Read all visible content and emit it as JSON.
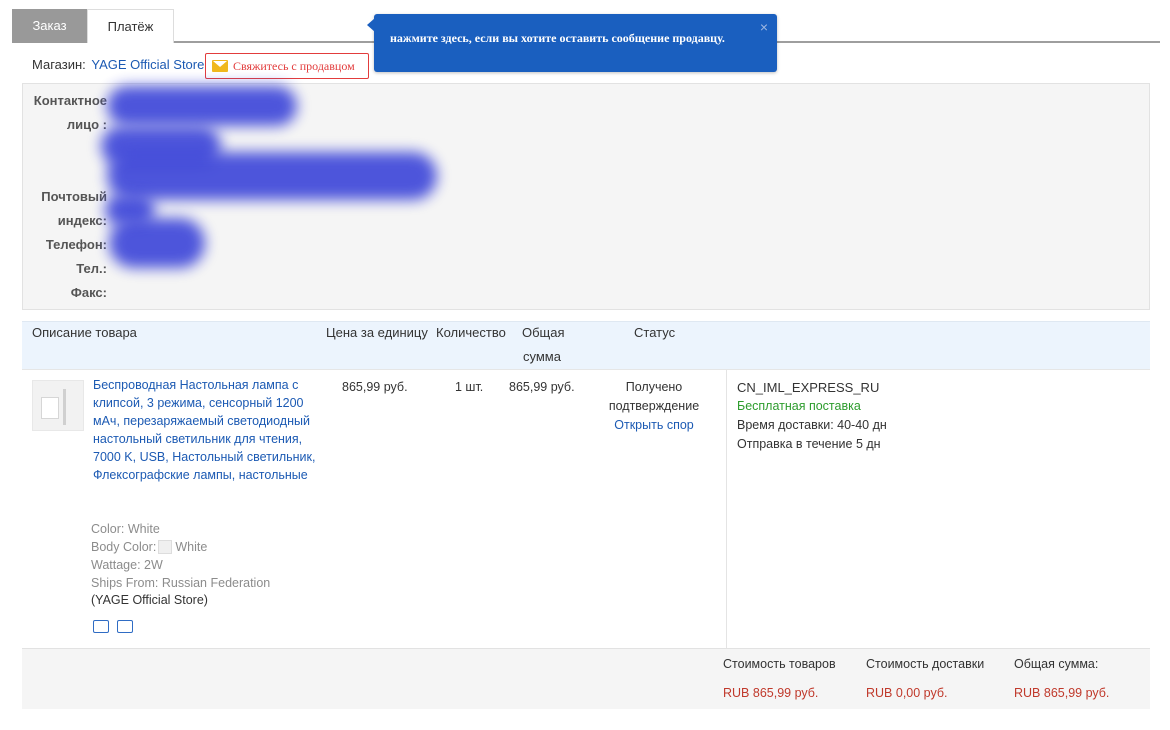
{
  "tabs": {
    "order": "Заказ",
    "payment": "Платёж"
  },
  "tooltip": {
    "text": "нажмите здесь, если вы хотите оставить сообщение продавцу.",
    "close": "×"
  },
  "store": {
    "label": "Магазин:",
    "name": "YAGE Official Store",
    "contact_button": "Свяжитесь с продавцом"
  },
  "contact": {
    "person_label_1": "Контактное",
    "person_label_2": "лицо :",
    "postal_label_1": "Почтовый",
    "postal_label_2": "индекс:",
    "phone_label": "Телефон:",
    "tel_label": "Тел.:",
    "fax_label": "Факс:"
  },
  "table_header": {
    "description": "Описание товара",
    "unit_price": "Цена за единицу",
    "quantity": "Количество",
    "total_1": "Общая",
    "total_2": "сумма",
    "status": "Статус"
  },
  "item": {
    "title": "Беспроводная Настольная лампа с клипсой, 3 режима, сенсорный 1200 мАч, перезаряжаемый светодиодный настольный светильник для чтения, 7000 K, USB, Настольный светильник, Флексографские лампы, настольные",
    "color": "Color: White",
    "body_color_label": "Body Color:",
    "body_color_value": "White",
    "wattage": "Wattage: 2W",
    "ships_from": "Ships From: Russian Federation",
    "store": "(YAGE Official Store)",
    "unit_price": "865,99 руб.",
    "quantity": "1 шт.",
    "total": "865,99 руб.",
    "status_1": "Получено",
    "status_2": "подтверждение",
    "dispute": "Открыть спор",
    "shipping_method": "CN_IML_EXPRESS_RU",
    "shipping_free": "Бесплатная поставка",
    "delivery_time": "Время доставки:  40-40 дн",
    "dispatch": "Отправка в течение  5 дн",
    "icons": [
      "truck-icon",
      "card-icon"
    ]
  },
  "summary": {
    "goods_label": "Стоимость товаров",
    "goods_value": "RUB 865,99 руб.",
    "shipping_label": "Стоимость доставки",
    "shipping_value": "RUB 0,00 руб.",
    "total_label": "Общая сумма:",
    "total_value": "RUB 865,99 руб."
  },
  "colors": {
    "accent": "#1c5ab3",
    "tooltip": "#1a5fbf",
    "price": "#c0392b",
    "free_shipping": "#2d9c2d",
    "blur": "#3f48d9"
  }
}
